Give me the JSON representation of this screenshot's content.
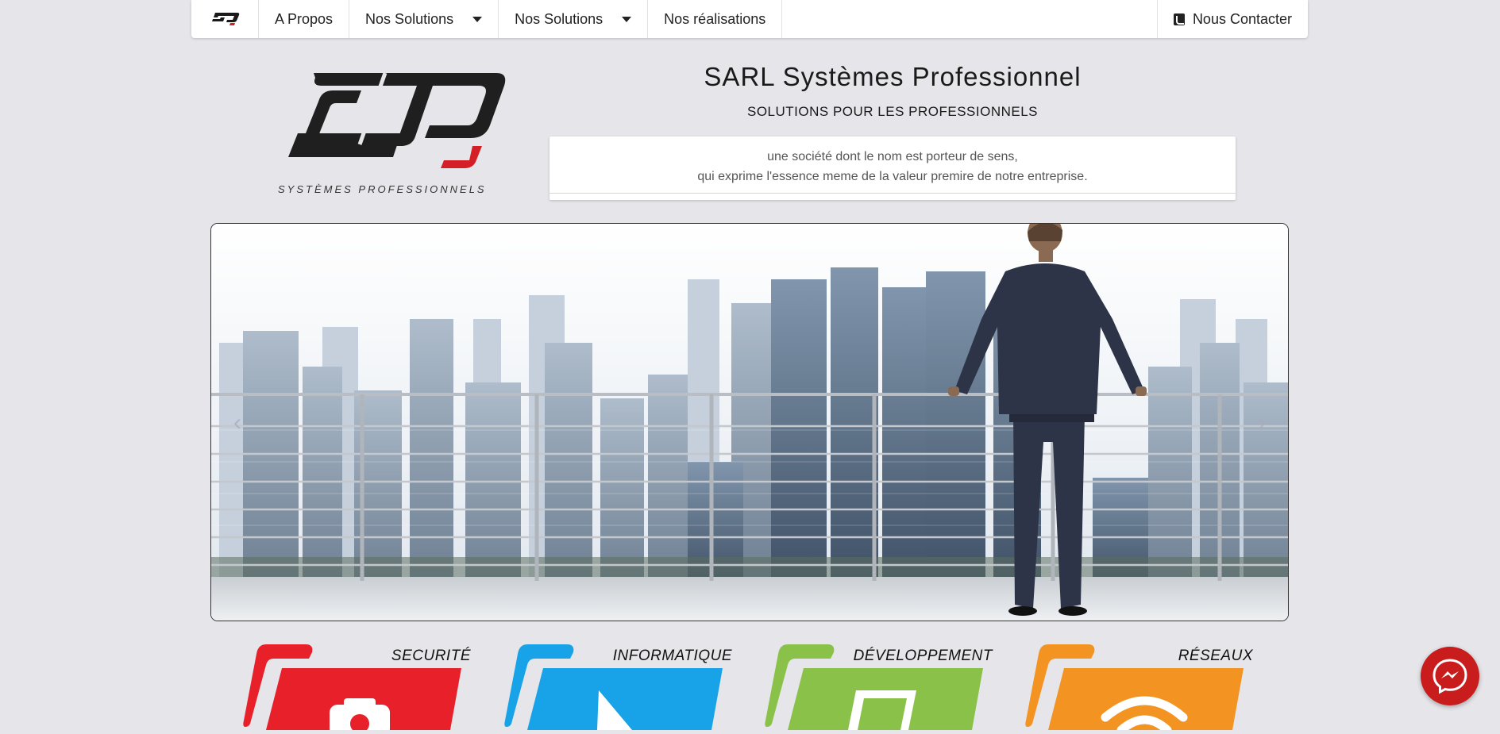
{
  "nav": {
    "items": [
      {
        "label": "A Propos"
      },
      {
        "label": "Nos Solutions"
      },
      {
        "label": "Nos Solutions"
      },
      {
        "label": "Nos réalisations"
      }
    ],
    "contact_label": "Nous Contacter"
  },
  "header": {
    "logo_text": "SYSTÈMES PROFESSIONNELS",
    "title": "SARL Systèmes Professionnel",
    "subtitle": "SOLUTIONS POUR LES PROFESSIONNELS",
    "tagline_line1": "une société dont le nom est porteur de sens,",
    "tagline_line2": "qui exprime l'essence meme de la valeur premire de notre entreprise."
  },
  "carousel": {
    "prev_symbol": "‹",
    "next_symbol": "›"
  },
  "services": [
    {
      "label": "SECURITÉ",
      "color": "#e8202a",
      "icon": "camera-icon"
    },
    {
      "label": "INFORMATIQUE",
      "color": "#18a3e8",
      "icon": "cursor-icon"
    },
    {
      "label": "DÉVELOPPEMENT",
      "color": "#8ac249",
      "icon": "tablet-icon"
    },
    {
      "label": "RÉSEAUX",
      "color": "#f39321",
      "icon": "wifi-icon"
    }
  ],
  "colors": {
    "background": "#e6e6ea",
    "logo_red": "#d41f26",
    "messenger": "#c91c1c"
  }
}
